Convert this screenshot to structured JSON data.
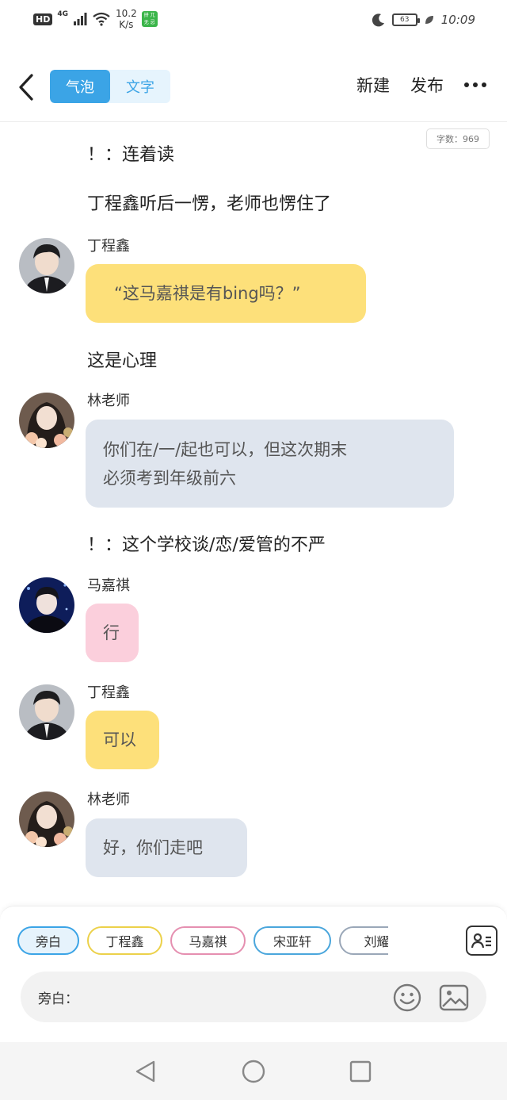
{
  "status_bar": {
    "hd": "HD",
    "network": "4G",
    "speed_value": "10.2",
    "speed_unit": "K/s",
    "app_badge": "拼 兀 无 忌",
    "battery": "63",
    "time": "10:09"
  },
  "header": {
    "tabs": [
      {
        "label": "气泡",
        "active": true
      },
      {
        "label": "文字",
        "active": false
      }
    ],
    "new_label": "新建",
    "publish_label": "发布"
  },
  "word_count": "字数：969",
  "chat": [
    {
      "type": "narration",
      "text": "！：连着读"
    },
    {
      "type": "narration",
      "text": "丁程鑫听后一愣，老师也愣住了"
    },
    {
      "type": "message",
      "speaker": "丁程鑫",
      "text": "“这马嘉祺是有bing吗？”",
      "color": "#fde07a"
    },
    {
      "type": "narration",
      "text": "这是心理"
    },
    {
      "type": "message",
      "speaker": "林老师",
      "text_lines": [
        "你们在/一/起也可以，但这次期末",
        "必须考到年级前六"
      ],
      "color": "#dfe5ee"
    },
    {
      "type": "narration",
      "text": "！：这个学校谈/恋/爱管的不严"
    },
    {
      "type": "message",
      "speaker": "马嘉祺",
      "text": "行",
      "color": "#fbcfdc"
    },
    {
      "type": "message",
      "speaker": "丁程鑫",
      "text": "可以",
      "color": "#fde07a"
    },
    {
      "type": "message",
      "speaker": "林老师",
      "text": "好，你们走吧",
      "color": "#dfe5ee"
    }
  ],
  "roles": [
    "旁白",
    "丁程鑫",
    "马嘉祺",
    "宋亚轩",
    "刘耀"
  ],
  "input": {
    "label": "旁白："
  }
}
